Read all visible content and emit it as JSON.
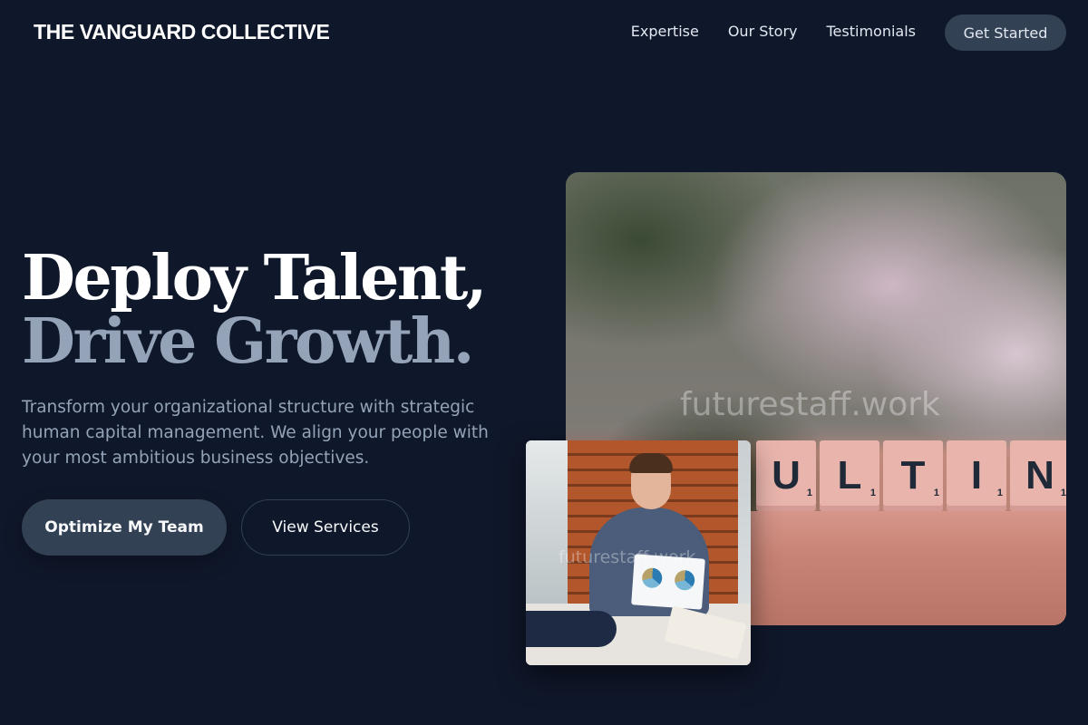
{
  "nav": {
    "brand": "THE VANGUARD COLLECTIVE",
    "links": [
      "Expertise",
      "Our Story",
      "Testimonials"
    ],
    "cta_label": "Get Started"
  },
  "hero": {
    "headline_line1": "Deploy Talent,",
    "headline_line2": "Drive Growth.",
    "description": "Transform your organizational structure with strategic human capital management. We align your people with your most ambitious business objectives.",
    "primary_button": "Optimize My Team",
    "secondary_button": "View Services"
  },
  "images": {
    "main_watermark": "futurestaff.work",
    "main_tiles": [
      "U",
      "L",
      "T",
      "I",
      "N"
    ],
    "small_watermark": "futurestaff.work"
  },
  "colors": {
    "background": "#0f172a",
    "accent_muted": "#94a3b8",
    "button": "#334155"
  }
}
